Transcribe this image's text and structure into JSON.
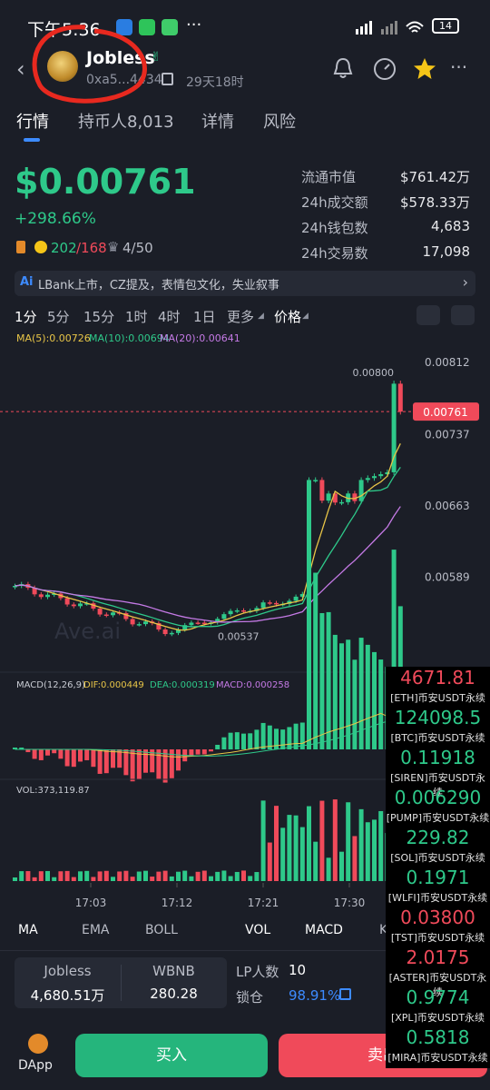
{
  "status_bar": {
    "time": "下午5:36",
    "battery": "14"
  },
  "header": {
    "token_name": "Jobless",
    "address": "0xa5...4434",
    "age": "29天18时"
  },
  "tabs": [
    {
      "label": "行情"
    },
    {
      "label": "持币人8,013"
    },
    {
      "label": "详情"
    },
    {
      "label": "风险"
    }
  ],
  "price": {
    "value": "$0.00761",
    "change": "+298.66%",
    "badge1": "202",
    "badge1b": "/168",
    "badge2": "4/50"
  },
  "stats": [
    {
      "label": "流通市值",
      "value": "$761.42万"
    },
    {
      "label": "24h成交额",
      "value": "$578.33万"
    },
    {
      "label": "24h钱包数",
      "value": "4,683"
    },
    {
      "label": "24h交易数",
      "value": "17,098"
    }
  ],
  "news": {
    "ai": "Ai",
    "text": "LBank上市，CZ提及，表情包文化，失业叙事"
  },
  "timeframes": [
    {
      "label": "1分"
    },
    {
      "label": "5分"
    },
    {
      "label": "15分"
    },
    {
      "label": "1时"
    },
    {
      "label": "4时"
    },
    {
      "label": "1日"
    },
    {
      "label": "更多"
    },
    {
      "label": "价格"
    }
  ],
  "chart_data": {
    "type": "candlestick",
    "ma_labels": {
      "ma5": "MA(5):0.00726",
      "ma10": "MA(10):0.00694",
      "ma20": "MA(20):0.00641"
    },
    "y_ticks": [
      "0.00812",
      "0.00737",
      "0.00663",
      "0.00589"
    ],
    "y_tick_values": [
      0.00812,
      0.00737,
      0.00663,
      0.00589
    ],
    "ylim": [
      0.00514,
      0.0083
    ],
    "current_price": "0.00761",
    "current_price_value": 0.00761,
    "high_label": "0.00800",
    "high_value": 0.008,
    "low_label": "0.00537",
    "low_value": 0.00537,
    "x_ticks": [
      "17:03",
      "17:12",
      "17:21",
      "17:30"
    ],
    "watermark": "Ave.ai",
    "macd_label": "MACD(12,26,9)",
    "dif_label": "DIF:0.000449",
    "dea_label": "DEA:0.000319",
    "macd_val_label": "MACD:0.000258",
    "vol_label": "VOL:373,119.87",
    "colors": {
      "up": "#2ec98a",
      "down": "#f04a5a",
      "ma5": "#e8c547",
      "ma10": "#2ec98a",
      "ma20": "#c57ae6"
    }
  },
  "indicators": [
    {
      "label": "MA"
    },
    {
      "label": "EMA"
    },
    {
      "label": "BOLL"
    },
    {
      "label": "VOL"
    },
    {
      "label": "MACD"
    },
    {
      "label": "KD"
    }
  ],
  "pool": {
    "token_a": "Jobless",
    "amount_a": "4,680.51万",
    "token_b": "WBNB",
    "amount_b": "280.28",
    "lp_label": "LP人数",
    "lp_value": "10",
    "lock_label": "锁仓",
    "lock_value": "98.91%"
  },
  "ticker_overlay": [
    {
      "price": "4671.81",
      "name": "[ETH]币安USDT永续",
      "color": "#f04a5a"
    },
    {
      "price": "124098.5",
      "name": "[BTC]币安USDT永续",
      "color": "#2ec98a"
    },
    {
      "price": "0.11918",
      "name": "[SIREN]币安USDT永续",
      "color": "#2ec98a"
    },
    {
      "price": "0.006290",
      "name": "[PUMP]币安USDT永续",
      "color": "#2ec98a"
    },
    {
      "price": "229.82",
      "name": "[SOL]币安USDT永续",
      "color": "#2ec98a"
    },
    {
      "price": "0.1971",
      "name": "[WLFI]币安USDT永续",
      "color": "#2ec98a"
    },
    {
      "price": "0.03800",
      "name": "[TST]币安USDT永续",
      "color": "#f04a5a"
    },
    {
      "price": "2.0175",
      "name": "[ASTER]币安USDT永续",
      "color": "#f04a5a"
    },
    {
      "price": "0.9774",
      "name": "[XPL]币安USDT永续",
      "color": "#2ec98a"
    },
    {
      "price": "0.5818",
      "name": "[MIRA]币安USDT永续",
      "color": "#2ec98a"
    }
  ],
  "bottom": {
    "dapp": "DApp",
    "buy": "买入",
    "sell": "卖出"
  }
}
